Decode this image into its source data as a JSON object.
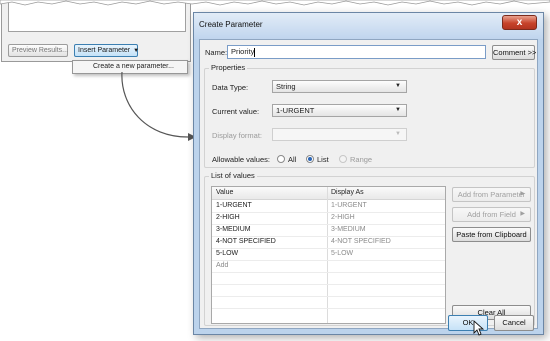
{
  "background_window": {
    "preview_button": "Preview Results...",
    "insert_button": "Insert Parameter",
    "menu_item": "Create a new parameter..."
  },
  "dialog": {
    "title": "Create Parameter",
    "close_glyph": "x",
    "name_label": "Name:",
    "name_value": "Priority",
    "comment_button": "Comment >>",
    "properties": {
      "title": "Properties",
      "data_type_label": "Data Type:",
      "data_type_value": "String",
      "current_value_label": "Current value:",
      "current_value_value": "1-URGENT",
      "display_format_label": "Display format:",
      "display_format_value": "",
      "allowable_label": "Allowable values:",
      "options": [
        "All",
        "List",
        "Range"
      ],
      "selected_option": "List"
    },
    "list_of_values": {
      "title": "List of values",
      "columns": [
        "Value",
        "Display As"
      ],
      "rows": [
        {
          "value": "1-URGENT",
          "display": "1-URGENT"
        },
        {
          "value": "2-HIGH",
          "display": "2-HIGH"
        },
        {
          "value": "3-MEDIUM",
          "display": "3-MEDIUM"
        },
        {
          "value": "4-NOT SPECIFIED",
          "display": "4-NOT SPECIFIED"
        },
        {
          "value": "5-LOW",
          "display": "5-LOW"
        }
      ],
      "add_placeholder": "Add",
      "add_from_parameter": "Add from Parameter",
      "add_from_field": "Add from Field",
      "paste_from_clipboard": "Paste from Clipboard",
      "clear_all": "Clear All"
    },
    "ok_button": "OK",
    "cancel_button": "Cancel"
  },
  "colors": {
    "dialog_frame": "#bcd3ec",
    "close_button": "#c7432b",
    "accent": "#3c7fb1"
  },
  "icons": [
    "close-icon",
    "dropdown-arrow-icon",
    "submenu-arrow-icon",
    "mouse-pointer-icon",
    "curved-arrow-icon"
  ]
}
